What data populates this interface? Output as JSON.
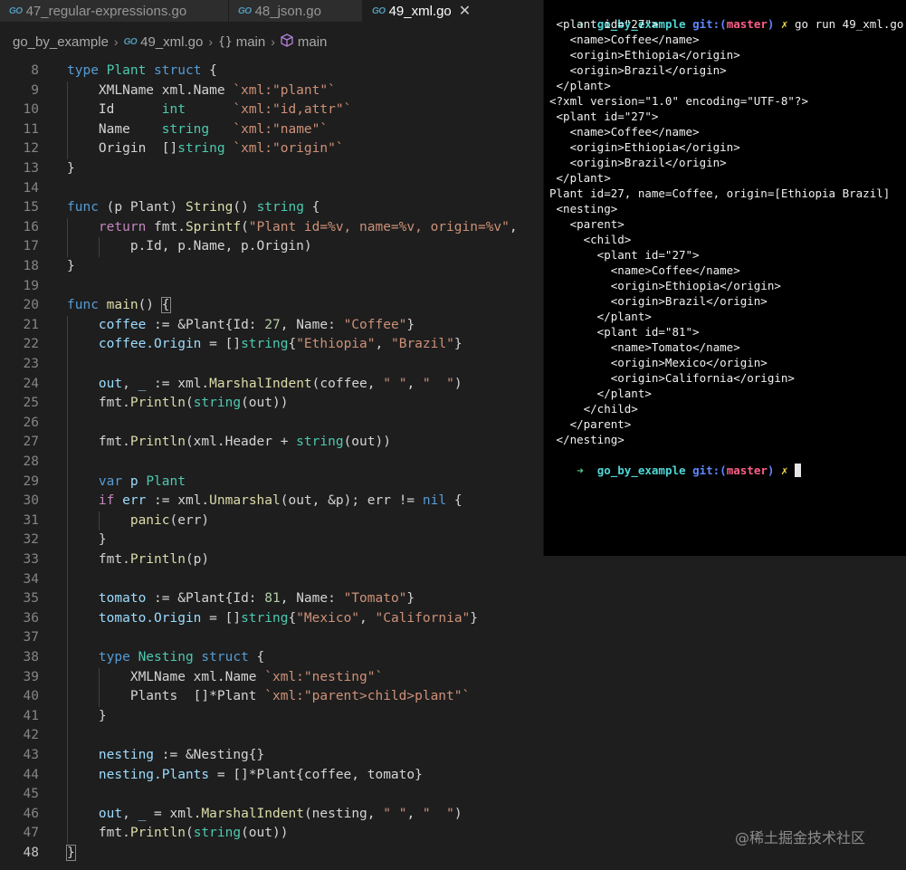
{
  "tabs": [
    {
      "icon": "GO",
      "label": "47_regular-expressions.go"
    },
    {
      "icon": "GO",
      "label": "48_json.go"
    },
    {
      "icon": "GO",
      "label": "49_xml.go",
      "close": "✕"
    }
  ],
  "breadcrumb": {
    "folder": "go_by_example",
    "file_icon": "GO",
    "file": "49_xml.go",
    "fn_icon": "{}",
    "symbol1": "main",
    "symbol2": "main",
    "sep": "›"
  },
  "editor": {
    "current_line": 48,
    "lines": [
      {
        "n": "8",
        "tokens": [
          [
            "k",
            "type "
          ],
          [
            "t",
            "Plant "
          ],
          [
            "k",
            "struct "
          ],
          [
            "p",
            "{"
          ]
        ]
      },
      {
        "n": "9",
        "tokens": [
          [
            "p",
            "    XMLName xml.Name "
          ],
          [
            "s",
            "`xml:\"plant\"`"
          ]
        ]
      },
      {
        "n": "10",
        "tokens": [
          [
            "p",
            "    Id      "
          ],
          [
            "t",
            "int"
          ],
          [
            "p",
            "      "
          ],
          [
            "s",
            "`xml:\"id,attr\"`"
          ]
        ]
      },
      {
        "n": "11",
        "tokens": [
          [
            "p",
            "    Name    "
          ],
          [
            "t",
            "string"
          ],
          [
            "p",
            "   "
          ],
          [
            "s",
            "`xml:\"name\"`"
          ]
        ]
      },
      {
        "n": "12",
        "tokens": [
          [
            "p",
            "    Origin  []"
          ],
          [
            "t",
            "string"
          ],
          [
            "p",
            " "
          ],
          [
            "s",
            "`xml:\"origin\"`"
          ]
        ]
      },
      {
        "n": "13",
        "tokens": [
          [
            "p",
            "}"
          ]
        ]
      },
      {
        "n": "14",
        "tokens": []
      },
      {
        "n": "15",
        "tokens": [
          [
            "k",
            "func "
          ],
          [
            "p",
            "(p Plant) "
          ],
          [
            "f",
            "String"
          ],
          [
            "p",
            "() "
          ],
          [
            "t",
            "string"
          ],
          [
            "p",
            " {"
          ]
        ]
      },
      {
        "n": "16",
        "tokens": [
          [
            "p",
            "    "
          ],
          [
            "c",
            "return "
          ],
          [
            "p",
            "fmt."
          ],
          [
            "f",
            "Sprintf"
          ],
          [
            "p",
            "("
          ],
          [
            "s",
            "\"Plant id=%v, name=%v, origin=%v\""
          ],
          [
            "p",
            ","
          ]
        ]
      },
      {
        "n": "17",
        "tokens": [
          [
            "p",
            "        p.Id, p.Name, p.Origin)"
          ]
        ]
      },
      {
        "n": "18",
        "tokens": [
          [
            "p",
            "}"
          ]
        ]
      },
      {
        "n": "19",
        "tokens": []
      },
      {
        "n": "20",
        "tokens": [
          [
            "k",
            "func "
          ],
          [
            "f",
            "main"
          ],
          [
            "p",
            "() "
          ],
          [
            "bm",
            "{"
          ]
        ]
      },
      {
        "n": "21",
        "tokens": [
          [
            "p",
            "    "
          ],
          [
            "v",
            "coffee"
          ],
          [
            "p",
            " := &Plant{Id: "
          ],
          [
            "n",
            "27"
          ],
          [
            "p",
            ", Name: "
          ],
          [
            "s",
            "\"Coffee\""
          ],
          [
            "p",
            "}"
          ]
        ]
      },
      {
        "n": "22",
        "tokens": [
          [
            "p",
            "    "
          ],
          [
            "v",
            "coffee.Origin"
          ],
          [
            "p",
            " = []"
          ],
          [
            "t",
            "string"
          ],
          [
            "p",
            "{"
          ],
          [
            "s",
            "\"Ethiopia\""
          ],
          [
            "p",
            ", "
          ],
          [
            "s",
            "\"Brazil\""
          ],
          [
            "p",
            "}"
          ]
        ]
      },
      {
        "n": "23",
        "tokens": []
      },
      {
        "n": "24",
        "tokens": [
          [
            "p",
            "    "
          ],
          [
            "v",
            "out"
          ],
          [
            "p",
            ", "
          ],
          [
            "v",
            "_"
          ],
          [
            "p",
            " := xml."
          ],
          [
            "f",
            "MarshalIndent"
          ],
          [
            "p",
            "(coffee, "
          ],
          [
            "s",
            "\" \""
          ],
          [
            "p",
            ", "
          ],
          [
            "s",
            "\"  \""
          ],
          [
            "p",
            ")"
          ]
        ]
      },
      {
        "n": "25",
        "tokens": [
          [
            "p",
            "    fmt."
          ],
          [
            "f",
            "Println"
          ],
          [
            "p",
            "("
          ],
          [
            "t",
            "string"
          ],
          [
            "p",
            "(out))"
          ]
        ]
      },
      {
        "n": "26",
        "tokens": []
      },
      {
        "n": "27",
        "tokens": [
          [
            "p",
            "    fmt."
          ],
          [
            "f",
            "Println"
          ],
          [
            "p",
            "(xml.Header + "
          ],
          [
            "t",
            "string"
          ],
          [
            "p",
            "(out))"
          ]
        ]
      },
      {
        "n": "28",
        "tokens": []
      },
      {
        "n": "29",
        "tokens": [
          [
            "p",
            "    "
          ],
          [
            "k",
            "var "
          ],
          [
            "v",
            "p "
          ],
          [
            "t",
            "Plant"
          ]
        ]
      },
      {
        "n": "30",
        "tokens": [
          [
            "p",
            "    "
          ],
          [
            "c",
            "if "
          ],
          [
            "v",
            "err"
          ],
          [
            "p",
            " := xml."
          ],
          [
            "f",
            "Unmarshal"
          ],
          [
            "p",
            "(out, &p); err != "
          ],
          [
            "k",
            "nil"
          ],
          [
            "p",
            " {"
          ]
        ]
      },
      {
        "n": "31",
        "tokens": [
          [
            "p",
            "        "
          ],
          [
            "f",
            "panic"
          ],
          [
            "p",
            "(err)"
          ]
        ]
      },
      {
        "n": "32",
        "tokens": [
          [
            "p",
            "    }"
          ]
        ]
      },
      {
        "n": "33",
        "tokens": [
          [
            "p",
            "    fmt."
          ],
          [
            "f",
            "Println"
          ],
          [
            "p",
            "(p)"
          ]
        ]
      },
      {
        "n": "34",
        "tokens": []
      },
      {
        "n": "35",
        "tokens": [
          [
            "p",
            "    "
          ],
          [
            "v",
            "tomato"
          ],
          [
            "p",
            " := &Plant{Id: "
          ],
          [
            "n",
            "81"
          ],
          [
            "p",
            ", Name: "
          ],
          [
            "s",
            "\"Tomato\""
          ],
          [
            "p",
            "}"
          ]
        ]
      },
      {
        "n": "36",
        "tokens": [
          [
            "p",
            "    "
          ],
          [
            "v",
            "tomato.Origin"
          ],
          [
            "p",
            " = []"
          ],
          [
            "t",
            "string"
          ],
          [
            "p",
            "{"
          ],
          [
            "s",
            "\"Mexico\""
          ],
          [
            "p",
            ", "
          ],
          [
            "s",
            "\"California\""
          ],
          [
            "p",
            "}"
          ]
        ]
      },
      {
        "n": "37",
        "tokens": []
      },
      {
        "n": "38",
        "tokens": [
          [
            "p",
            "    "
          ],
          [
            "k",
            "type "
          ],
          [
            "t",
            "Nesting "
          ],
          [
            "k",
            "struct "
          ],
          [
            "p",
            "{"
          ]
        ]
      },
      {
        "n": "39",
        "tokens": [
          [
            "p",
            "        XMLName xml.Name "
          ],
          [
            "s",
            "`xml:\"nesting\"`"
          ]
        ]
      },
      {
        "n": "40",
        "tokens": [
          [
            "p",
            "        Plants  []*Plant "
          ],
          [
            "s",
            "`xml:\"parent>child>plant\"`"
          ]
        ]
      },
      {
        "n": "41",
        "tokens": [
          [
            "p",
            "    }"
          ]
        ]
      },
      {
        "n": "42",
        "tokens": []
      },
      {
        "n": "43",
        "tokens": [
          [
            "p",
            "    "
          ],
          [
            "v",
            "nesting"
          ],
          [
            "p",
            " := &Nesting{}"
          ]
        ]
      },
      {
        "n": "44",
        "tokens": [
          [
            "p",
            "    "
          ],
          [
            "v",
            "nesting.Plants"
          ],
          [
            "p",
            " = []*Plant{coffee, tomato}"
          ]
        ]
      },
      {
        "n": "45",
        "tokens": []
      },
      {
        "n": "46",
        "tokens": [
          [
            "p",
            "    "
          ],
          [
            "v",
            "out"
          ],
          [
            "p",
            ", "
          ],
          [
            "v",
            "_"
          ],
          [
            "p",
            " = xml."
          ],
          [
            "f",
            "MarshalIndent"
          ],
          [
            "p",
            "(nesting, "
          ],
          [
            "s",
            "\" \""
          ],
          [
            "p",
            ", "
          ],
          [
            "s",
            "\"  \""
          ],
          [
            "p",
            ")"
          ]
        ]
      },
      {
        "n": "47",
        "tokens": [
          [
            "p",
            "    fmt."
          ],
          [
            "f",
            "Println"
          ],
          [
            "p",
            "("
          ],
          [
            "t",
            "string"
          ],
          [
            "p",
            "(out))"
          ]
        ]
      },
      {
        "n": "48",
        "tokens": [
          [
            "bm",
            "}"
          ]
        ]
      }
    ]
  },
  "terminal": {
    "prompt": {
      "arrow": "➜",
      "dir": "go_by_example",
      "git": "git:(",
      "branch": "master",
      "git_close": ")",
      "dirty": "✗"
    },
    "command": "go run 49_xml.go",
    "output": [
      " <plant id=\"27\">",
      "   <name>Coffee</name>",
      "   <origin>Ethiopia</origin>",
      "   <origin>Brazil</origin>",
      " </plant>",
      "<?xml version=\"1.0\" encoding=\"UTF-8\"?>",
      " <plant id=\"27\">",
      "   <name>Coffee</name>",
      "   <origin>Ethiopia</origin>",
      "   <origin>Brazil</origin>",
      " </plant>",
      "Plant id=27, name=Coffee, origin=[Ethiopia Brazil]",
      " <nesting>",
      "   <parent>",
      "     <child>",
      "       <plant id=\"27\">",
      "         <name>Coffee</name>",
      "         <origin>Ethiopia</origin>",
      "         <origin>Brazil</origin>",
      "       </plant>",
      "       <plant id=\"81\">",
      "         <name>Tomato</name>",
      "         <origin>Mexico</origin>",
      "         <origin>California</origin>",
      "       </plant>",
      "     </child>",
      "   </parent>",
      " </nesting>"
    ]
  },
  "watermark": "@稀土掘金技术社区",
  "colors": {
    "editor_bg": "#1e1e1e",
    "terminal_bg": "#000000",
    "keyword": "#569cd6",
    "type": "#4ec9b0",
    "string": "#ce9178",
    "function": "#dcdcaa"
  }
}
